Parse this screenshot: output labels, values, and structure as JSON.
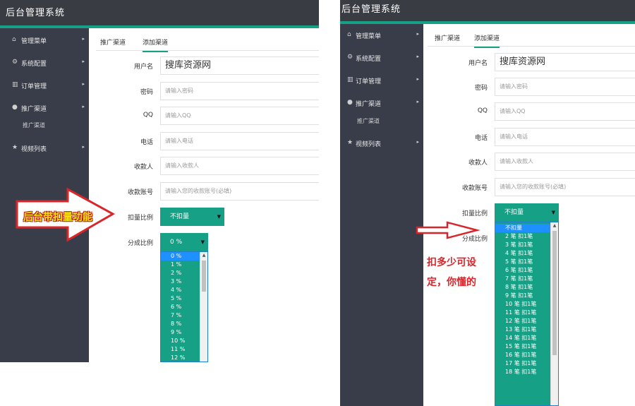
{
  "app": {
    "title": "后台管理系统"
  },
  "sidebar": {
    "items": [
      {
        "icon": "home-icon",
        "glyph": "⌂",
        "label": "管理菜单"
      },
      {
        "icon": "cogs-icon",
        "glyph": "⚙",
        "label": "系统配置"
      },
      {
        "icon": "bar-chart-icon",
        "glyph": "▥",
        "label": "订单管理"
      },
      {
        "icon": "user-icon",
        "glyph": "●",
        "label": "推广渠道"
      },
      {
        "icon": "star-icon",
        "glyph": "★",
        "label": "视频列表"
      }
    ],
    "sub_item": "推广渠道",
    "arrow": "▸"
  },
  "tabs": [
    "推广渠道",
    "添加渠道"
  ],
  "form": {
    "username": {
      "label": "用户名",
      "value": "搜库资源网"
    },
    "password": {
      "label": "密码",
      "placeholder": "请输入密码"
    },
    "qq": {
      "label": "QQ",
      "placeholder": "请输入QQ"
    },
    "phone": {
      "label": "电话",
      "placeholder": "请输入电话"
    },
    "payee": {
      "label": "收款人",
      "placeholder": "请输入收款人"
    },
    "account": {
      "label": "收款账号",
      "placeholder": "请输入您的收款账号(必填)"
    },
    "deduct": {
      "label": "扣量比例",
      "value": "不扣量"
    },
    "share": {
      "label": "分成比例",
      "value": "0 %"
    }
  },
  "share_options": [
    "0 %",
    "1 %",
    "2 %",
    "3 %",
    "4 %",
    "5 %",
    "6 %",
    "7 %",
    "8 %",
    "9 %",
    "10 %",
    "11 %",
    "12 %"
  ],
  "deduct_options": [
    "不扣量",
    "2 笔 扣1笔",
    "3 笔 扣1笔",
    "4 笔 扣1笔",
    "5 笔 扣1笔",
    "6 笔 扣1笔",
    "7 笔 扣1笔",
    "8 笔 扣1笔",
    "9 笔 扣1笔",
    "10 笔 扣1笔",
    "11 笔 扣1笔",
    "12 笔 扣1笔",
    "13 笔 扣1笔",
    "14 笔 扣1笔",
    "15 笔 扣1笔",
    "16 笔 扣1笔",
    "17 笔 扣1笔",
    "18 笔 扣1笔"
  ],
  "caret": "▼",
  "scroll_up": "▲",
  "annotations": {
    "left": "后台带扣量功能",
    "right_line1": "扣多少可设",
    "right_line2": "定，你懂的"
  },
  "colors": {
    "topbar": "#3a3c44",
    "sidebar": "#393d49",
    "accent": "#16a085",
    "selected": "#1e90ff",
    "arrow_red": "#d9262b",
    "annotation_yellow": "#f5e50a"
  }
}
